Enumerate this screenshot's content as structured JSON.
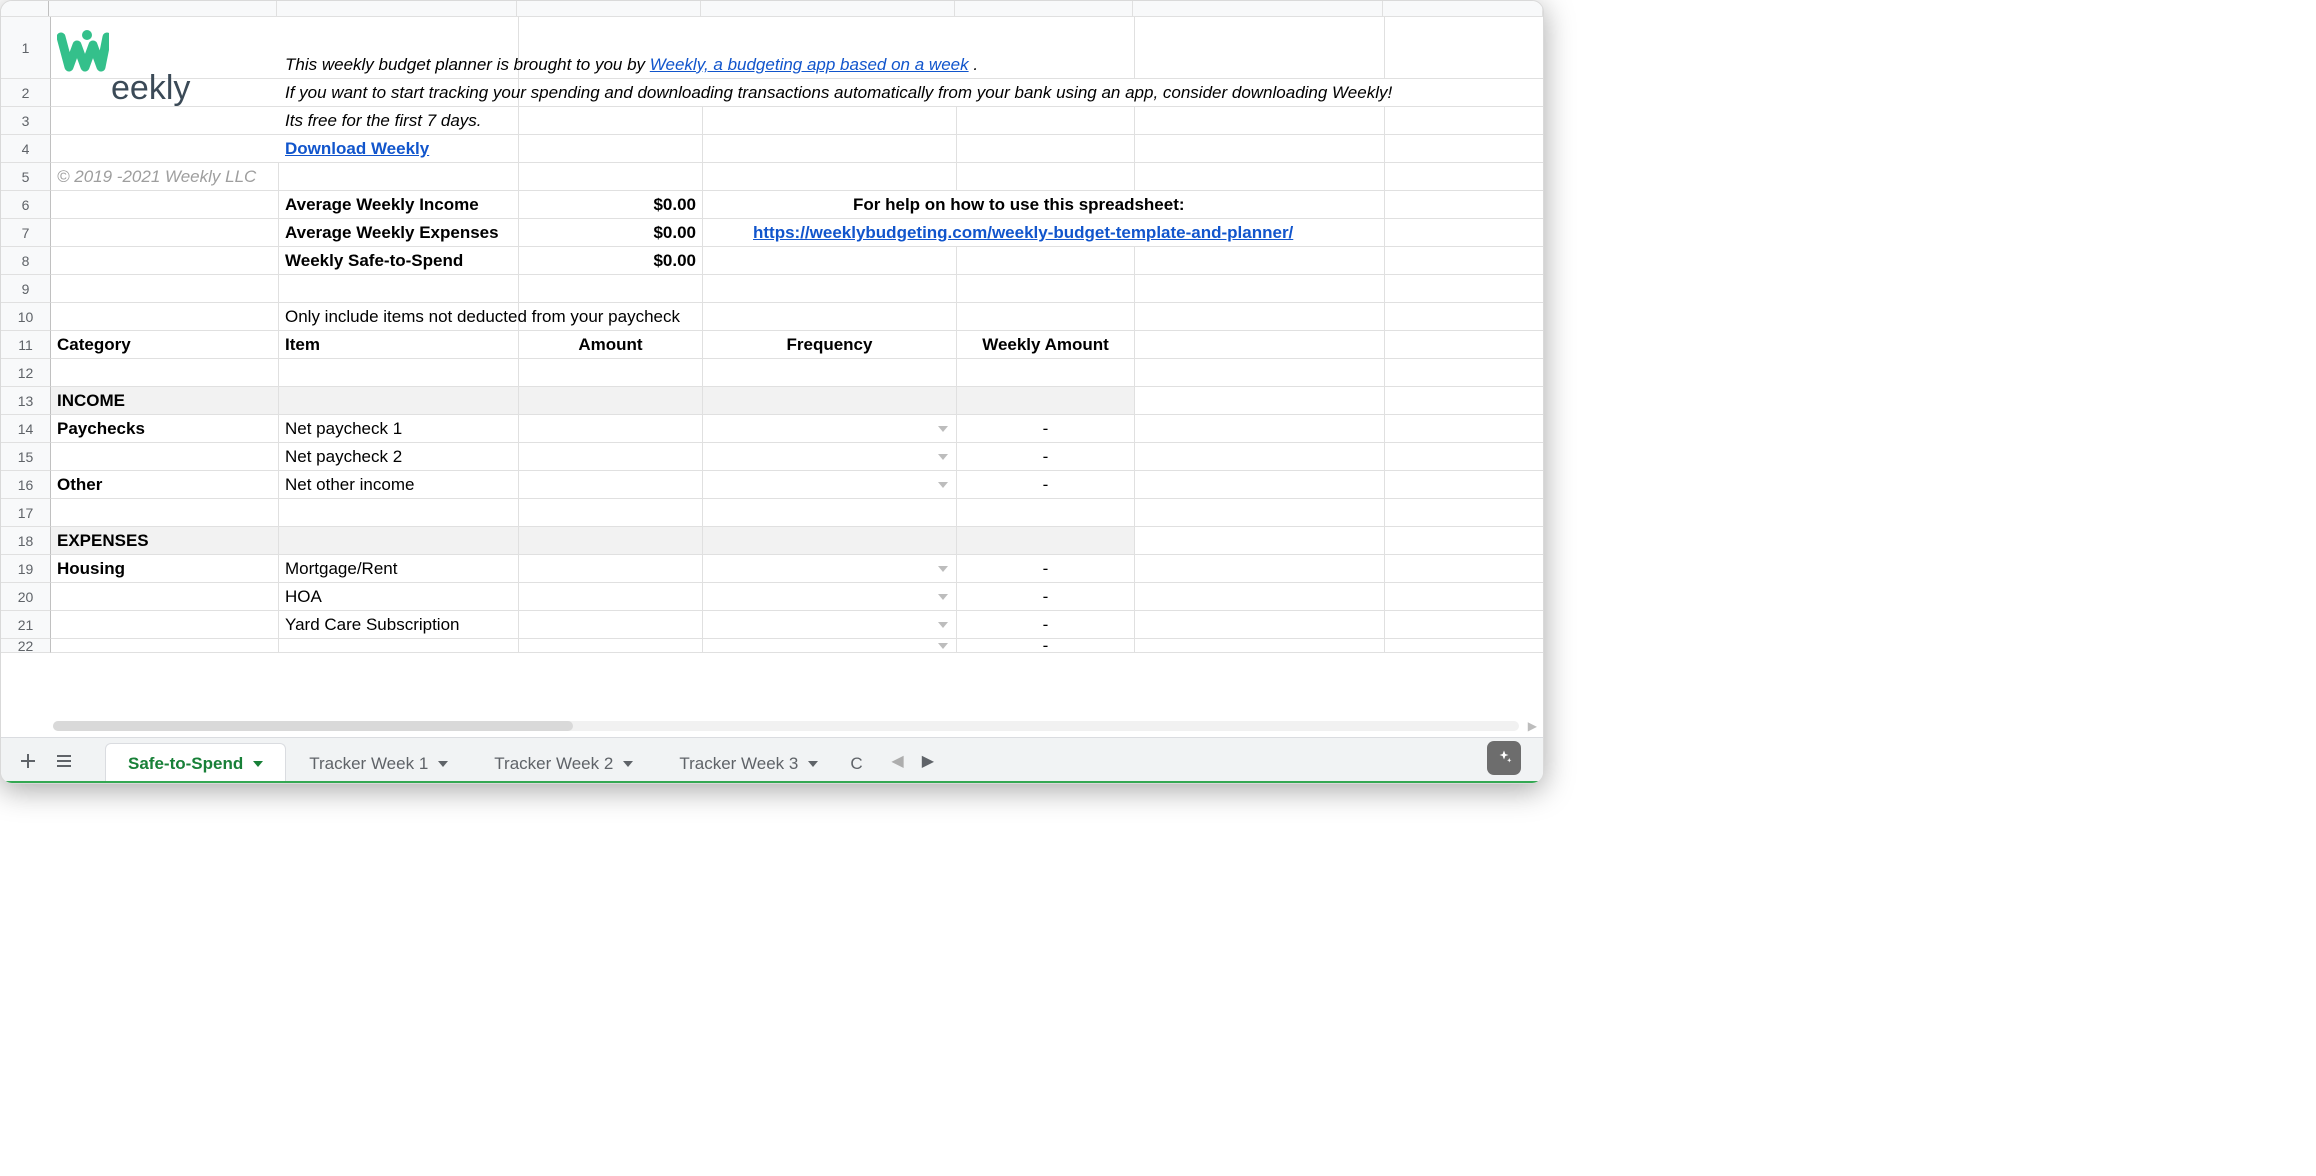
{
  "logo_text": "eekly",
  "copyright": "© 2019 -2021 Weekly LLC",
  "intro": {
    "line1_prefix": "This weekly budget planner is brought to you by ",
    "line1_link": "Weekly, a budgeting app based on a week",
    "line1_suffix": ".",
    "line2": "If you want to start tracking your spending and downloading transactions automatically from your bank using an app, consider downloading Weekly!",
    "line3": "Its free for the first 7 days.",
    "download_link": "Download Weekly"
  },
  "summary": {
    "avg_income_label": "Average Weekly Income",
    "avg_income_value": "$0.00",
    "avg_expenses_label": "Average Weekly Expenses",
    "avg_expenses_value": "$0.00",
    "safe_to_spend_label": "Weekly Safe-to-Spend",
    "safe_to_spend_value": "$0.00",
    "help_label": "For help on how to use this spreadsheet:",
    "help_url": "https://weeklybudgeting.com/weekly-budget-template-and-planner/"
  },
  "note": "Only include items not deducted from your paycheck",
  "headers": {
    "category": "Category",
    "item": "Item",
    "amount": "Amount",
    "frequency": "Frequency",
    "weekly_amount": "Weekly Amount"
  },
  "sections": {
    "income": "INCOME",
    "expenses": "EXPENSES"
  },
  "rows": {
    "paychecks_label": "Paychecks",
    "other_label": "Other",
    "housing_label": "Housing",
    "net_paycheck_1": "Net paycheck 1",
    "net_paycheck_2": "Net paycheck 2",
    "net_other_income": "Net other income",
    "mortgage_rent": "Mortgage/Rent",
    "hoa": "HOA",
    "yard_care": "Yard Care Subscription",
    "dash": "-"
  },
  "row_numbers": [
    "1",
    "2",
    "3",
    "4",
    "5",
    "6",
    "7",
    "8",
    "9",
    "10",
    "11",
    "12",
    "13",
    "14",
    "15",
    "16",
    "17",
    "18",
    "19",
    "20",
    "21",
    "22"
  ],
  "tabs": {
    "active": "Safe-to-Spend",
    "others": [
      "Tracker Week 1",
      "Tracker Week 2",
      "Tracker Week 3"
    ],
    "truncated": "C"
  }
}
